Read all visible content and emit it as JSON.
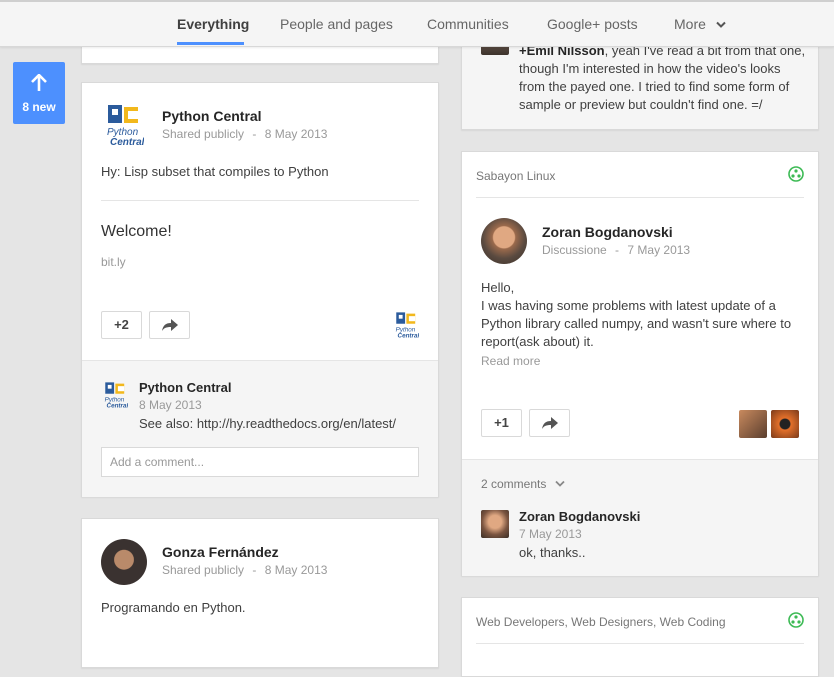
{
  "tabs": [
    {
      "label": "Everything",
      "active": true
    },
    {
      "label": "People and pages"
    },
    {
      "label": "Communities"
    },
    {
      "label": "Google+ posts"
    },
    {
      "label": "More"
    }
  ],
  "new_badge": {
    "label": "8 new"
  },
  "left_post1": {
    "author": "Python Central",
    "visibility": "Shared publicly",
    "separator": "-",
    "date": "8 May 2013",
    "text": "Hy: Lisp subset that compiles to Python",
    "link_title": "Welcome!",
    "link_domain": "bit.ly",
    "plus_count": "+2",
    "comment": {
      "author": "Python Central",
      "date": "8 May 2013",
      "text": "See also: http://hy.readthedocs.org/en/latest/"
    },
    "comment_placeholder": "Add a comment..."
  },
  "left_post2": {
    "author": "Gonza Fernández",
    "visibility": "Shared publicly",
    "separator": "-",
    "date": "8 May 2013",
    "text": "Programando en Python."
  },
  "right_top_comment": {
    "mention": "+Emil Nilsson",
    "lines": [
      ", yeah I've read a bit from that one,",
      "though I'm interested in how the video's looks",
      "from the payed one. I tried to find some form of",
      "sample or preview but couldn't find one. =/"
    ]
  },
  "right_post": {
    "community": "Sabayon Linux",
    "author": "Zoran Bogdanovski",
    "category": "Discussione",
    "separator": "-",
    "date": "7 May 2013",
    "lines": [
      "Hello,",
      "I was having some problems with latest update of a",
      "Python library called numpy, and wasn't sure where to",
      "report(ask about) it."
    ],
    "read_more": "Read more",
    "plus_count": "+1",
    "comments_count": "2 comments",
    "comment": {
      "author": "Zoran Bogdanovski",
      "date": "7 May 2013",
      "text": "ok, thanks.."
    }
  },
  "right_post2": {
    "communities": [
      "Web Developers",
      "Web Designers",
      "Web Coding"
    ],
    "community_sep": ", "
  },
  "colors": {
    "accent": "#4d90fe",
    "community_green": "#3cba54"
  },
  "icons": [
    "arrow-up-icon",
    "share-arrow-icon",
    "chevron-down-icon",
    "community-icon"
  ]
}
